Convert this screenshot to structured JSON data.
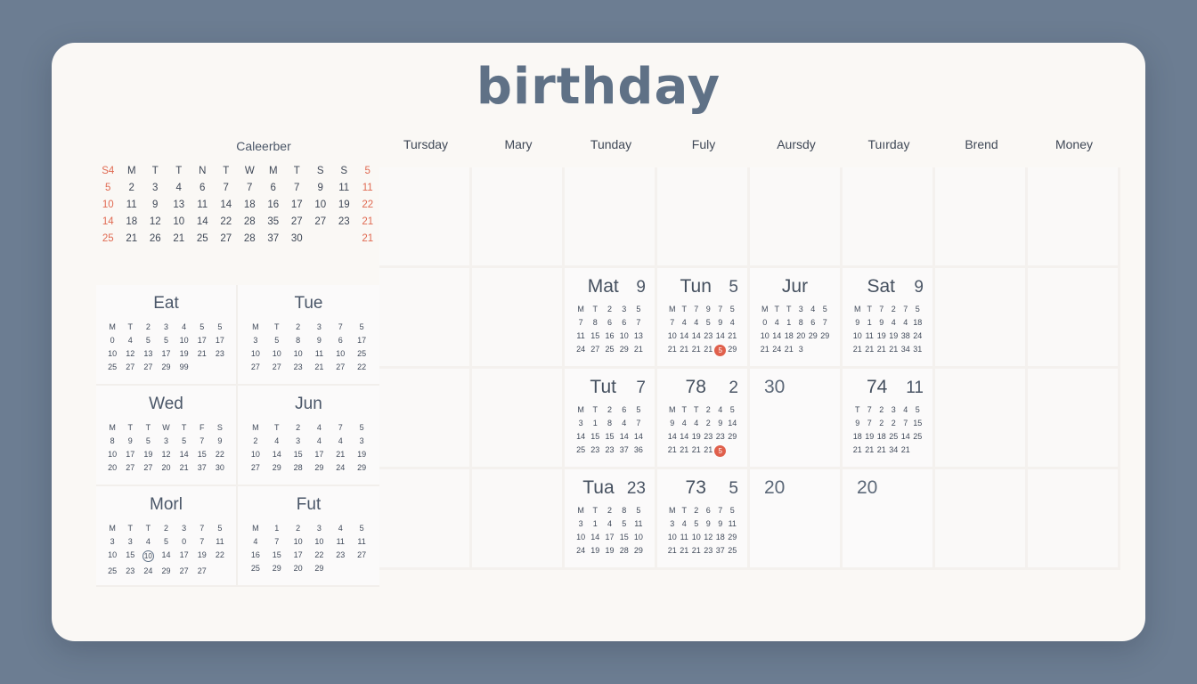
{
  "header": {
    "title": "birthday"
  },
  "mini_calendar": {
    "title": "Caleerber",
    "weekday_headers": [
      "S4",
      "M",
      "T",
      "T",
      "N",
      "T",
      "W",
      "M",
      "T",
      "S",
      "S",
      "5"
    ],
    "header_accent_index": [
      0,
      11
    ],
    "rows": [
      [
        "5",
        "2",
        "3",
        "4",
        "6",
        "7",
        "7",
        "6",
        "7",
        "9",
        "11",
        "11"
      ],
      [
        "10",
        "11",
        "9",
        "13",
        "11",
        "14",
        "18",
        "16",
        "17",
        "10",
        "19",
        "22"
      ],
      [
        "14",
        "18",
        "12",
        "10",
        "14",
        "22",
        "28",
        "35",
        "27",
        "27",
        "23",
        "21"
      ],
      [
        "25",
        "21",
        "26",
        "21",
        "25",
        "27",
        "28",
        "37",
        "30",
        "",
        "",
        "21"
      ]
    ],
    "accent_columns": [
      0,
      11
    ],
    "accent_color": "#e06a52"
  },
  "left_cards": [
    {
      "title": "Eat",
      "columns": 7,
      "headers": [
        "M",
        "T",
        "2",
        "3",
        "4",
        "5",
        "5"
      ],
      "rows": [
        [
          "0",
          "4",
          "5",
          "5",
          "10",
          "17",
          "17"
        ],
        [
          "10",
          "12",
          "13",
          "17",
          "19",
          "21",
          "23"
        ],
        [
          "25",
          "27",
          "27",
          "29",
          "99",
          "",
          ""
        ]
      ]
    },
    {
      "title": "Tue",
      "columns": 6,
      "headers": [
        "M",
        "T",
        "2",
        "3",
        "7",
        "5"
      ],
      "rows": [
        [
          "3",
          "5",
          "8",
          "9",
          "6",
          "17"
        ],
        [
          "10",
          "10",
          "10",
          "11",
          "10",
          "25"
        ],
        [
          "27",
          "27",
          "23",
          "21",
          "27",
          "22"
        ]
      ]
    },
    {
      "title": "Wed",
      "columns": 7,
      "headers": [
        "M",
        "T",
        "T",
        "W",
        "T",
        "F",
        "S"
      ],
      "rows": [
        [
          "8",
          "9",
          "5",
          "3",
          "5",
          "7",
          "9"
        ],
        [
          "10",
          "17",
          "19",
          "12",
          "14",
          "15",
          "22"
        ],
        [
          "20",
          "27",
          "27",
          "20",
          "21",
          "37",
          "30"
        ]
      ]
    },
    {
      "title": "Jun",
      "columns": 6,
      "headers": [
        "M",
        "T",
        "2",
        "4",
        "7",
        "5"
      ],
      "rows": [
        [
          "2",
          "4",
          "3",
          "4",
          "4",
          "3"
        ],
        [
          "10",
          "14",
          "15",
          "17",
          "21",
          "19"
        ],
        [
          "27",
          "29",
          "28",
          "29",
          "24",
          "29"
        ]
      ]
    },
    {
      "title": "Morl",
      "columns": 7,
      "headers": [
        "M",
        "T",
        "T",
        "2",
        "3",
        "7",
        "5"
      ],
      "rows": [
        [
          "3",
          "3",
          "4",
          "5",
          "0",
          "7",
          "11"
        ],
        [
          "10",
          "15",
          "10",
          "14",
          "17",
          "19",
          "22"
        ],
        [
          "25",
          "23",
          "24",
          "29",
          "27",
          "27",
          ""
        ]
      ],
      "ring_marker": {
        "row": 1,
        "col": 2,
        "value": "10"
      }
    },
    {
      "title": "Fut",
      "columns": 6,
      "headers": [
        "M",
        "1",
        "2",
        "3",
        "4",
        "5"
      ],
      "rows": [
        [
          "4",
          "7",
          "10",
          "10",
          "11",
          "11"
        ],
        [
          "16",
          "15",
          "17",
          "22",
          "23",
          "27"
        ],
        [
          "25",
          "29",
          "20",
          "29",
          "",
          ""
        ]
      ]
    }
  ],
  "week_header": [
    "Tursday",
    "Mary",
    "Tunday",
    "Fuly",
    "Aursdy",
    "Tuırday",
    "Brend",
    "Money"
  ],
  "day_cards": [
    {
      "row": 1,
      "col": 1,
      "empty": true
    },
    {
      "row": 1,
      "col": 2,
      "empty": true
    },
    {
      "row": 1,
      "col": 3,
      "empty": true
    },
    {
      "row": 1,
      "col": 4,
      "empty": true
    },
    {
      "row": 1,
      "col": 5,
      "empty": true
    },
    {
      "row": 1,
      "col": 6,
      "empty": true
    },
    {
      "row": 1,
      "col": 7,
      "empty": true
    },
    {
      "row": 1,
      "col": 8,
      "empty": true
    },
    {
      "row": 2,
      "col": 1,
      "empty": true
    },
    {
      "row": 2,
      "col": 2,
      "empty": true
    },
    {
      "row": 2,
      "col": 3,
      "title": "Mat",
      "badge": "9",
      "columns": 5,
      "headers": [
        "M",
        "T",
        "2",
        "3",
        "5"
      ],
      "rows": [
        [
          "7",
          "8",
          "6",
          "6",
          "7"
        ],
        [
          "11",
          "15",
          "16",
          "10",
          "13"
        ],
        [
          "24",
          "27",
          "25",
          "29",
          "21"
        ]
      ]
    },
    {
      "row": 2,
      "col": 4,
      "title": "Tun",
      "badge": "5",
      "columns": 6,
      "headers": [
        "M",
        "T",
        "7",
        "9",
        "7",
        "5"
      ],
      "rows": [
        [
          "7",
          "4",
          "4",
          "5",
          "9",
          "4"
        ],
        [
          "10",
          "14",
          "14",
          "23",
          "14",
          "21"
        ],
        [
          "21",
          "21",
          "21",
          "21",
          "@",
          "29"
        ]
      ],
      "dot_marker": {
        "row": 2,
        "col": 4,
        "value": "5"
      }
    },
    {
      "row": 2,
      "col": 5,
      "title": "Jur",
      "badge": "",
      "columns": 6,
      "headers": [
        "M",
        "T",
        "T",
        "3",
        "4",
        "5"
      ],
      "rows": [
        [
          "0",
          "4",
          "1",
          "8",
          "6",
          "7"
        ],
        [
          "10",
          "14",
          "18",
          "20",
          "29",
          "29"
        ],
        [
          "21",
          "24",
          "21",
          "3",
          "",
          ""
        ]
      ]
    },
    {
      "row": 2,
      "col": 6,
      "title": "Sat",
      "badge": "9",
      "columns": 6,
      "headers": [
        "M",
        "T",
        "7",
        "2",
        "7",
        "5"
      ],
      "rows": [
        [
          "9",
          "1",
          "9",
          "4",
          "4",
          "18"
        ],
        [
          "10",
          "11",
          "19",
          "19",
          "38",
          "24"
        ],
        [
          "21",
          "21",
          "21",
          "21",
          "34",
          "31"
        ]
      ]
    },
    {
      "row": 2,
      "col": 7,
      "empty": true
    },
    {
      "row": 2,
      "col": 8,
      "empty": true
    },
    {
      "row": 3,
      "col": 1,
      "empty": true
    },
    {
      "row": 3,
      "col": 2,
      "empty": true
    },
    {
      "row": 3,
      "col": 3,
      "title": "Tut",
      "badge": "7",
      "columns": 5,
      "headers": [
        "M",
        "T",
        "2",
        "6",
        "5"
      ],
      "rows": [
        [
          "3",
          "1",
          "8",
          "4",
          "7"
        ],
        [
          "14",
          "15",
          "15",
          "14",
          "14"
        ],
        [
          "25",
          "23",
          "23",
          "37",
          "36"
        ]
      ]
    },
    {
      "row": 3,
      "col": 4,
      "title": "78",
      "badge": "2",
      "columns": 6,
      "headers": [
        "M",
        "T",
        "T",
        "2",
        "4",
        "5"
      ],
      "rows": [
        [
          "9",
          "4",
          "4",
          "2",
          "9",
          "14"
        ],
        [
          "14",
          "14",
          "19",
          "23",
          "23",
          "29"
        ],
        [
          "21",
          "21",
          "21",
          "21",
          "@",
          ""
        ]
      ],
      "dot_marker": {
        "row": 2,
        "col": 4,
        "value": "5"
      }
    },
    {
      "row": 3,
      "col": 5,
      "title": "30",
      "title_only": true
    },
    {
      "row": 3,
      "col": 6,
      "title": "74",
      "badge": "11",
      "columns": 6,
      "headers": [
        "T",
        "7",
        "2",
        "3",
        "4",
        "5"
      ],
      "rows": [
        [
          "9",
          "7",
          "2",
          "2",
          "7",
          "15"
        ],
        [
          "18",
          "19",
          "18",
          "25",
          "14",
          "25"
        ],
        [
          "21",
          "21",
          "21",
          "34",
          "21",
          ""
        ]
      ]
    },
    {
      "row": 3,
      "col": 7,
      "empty": true
    },
    {
      "row": 3,
      "col": 8,
      "empty": true
    },
    {
      "row": 4,
      "col": 1,
      "empty": true
    },
    {
      "row": 4,
      "col": 2,
      "empty": true
    },
    {
      "row": 4,
      "col": 3,
      "title": "Tua",
      "badge": "23",
      "columns": 5,
      "headers": [
        "M",
        "T",
        "2",
        "8",
        "5"
      ],
      "rows": [
        [
          "3",
          "1",
          "4",
          "5",
          "11"
        ],
        [
          "10",
          "14",
          "17",
          "15",
          "10"
        ],
        [
          "24",
          "19",
          "19",
          "28",
          "29"
        ]
      ]
    },
    {
      "row": 4,
      "col": 4,
      "title": "73",
      "badge": "5",
      "columns": 6,
      "headers": [
        "M",
        "T",
        "2",
        "6",
        "7",
        "5"
      ],
      "rows": [
        [
          "3",
          "4",
          "5",
          "9",
          "9",
          "11"
        ],
        [
          "10",
          "11",
          "10",
          "12",
          "18",
          "29"
        ],
        [
          "21",
          "21",
          "21",
          "23",
          "37",
          "25"
        ]
      ]
    },
    {
      "row": 4,
      "col": 5,
      "title": "20",
      "title_only": true
    },
    {
      "row": 4,
      "col": 6,
      "title": "20",
      "title_only": true
    },
    {
      "row": 4,
      "col": 7,
      "empty": true
    },
    {
      "row": 4,
      "col": 8,
      "empty": true
    }
  ],
  "colors": {
    "background": "#6c7d92",
    "card": "#faf8f5",
    "title": "#5f7186",
    "accent_red": "#e0604c",
    "text": "#404a5a"
  }
}
